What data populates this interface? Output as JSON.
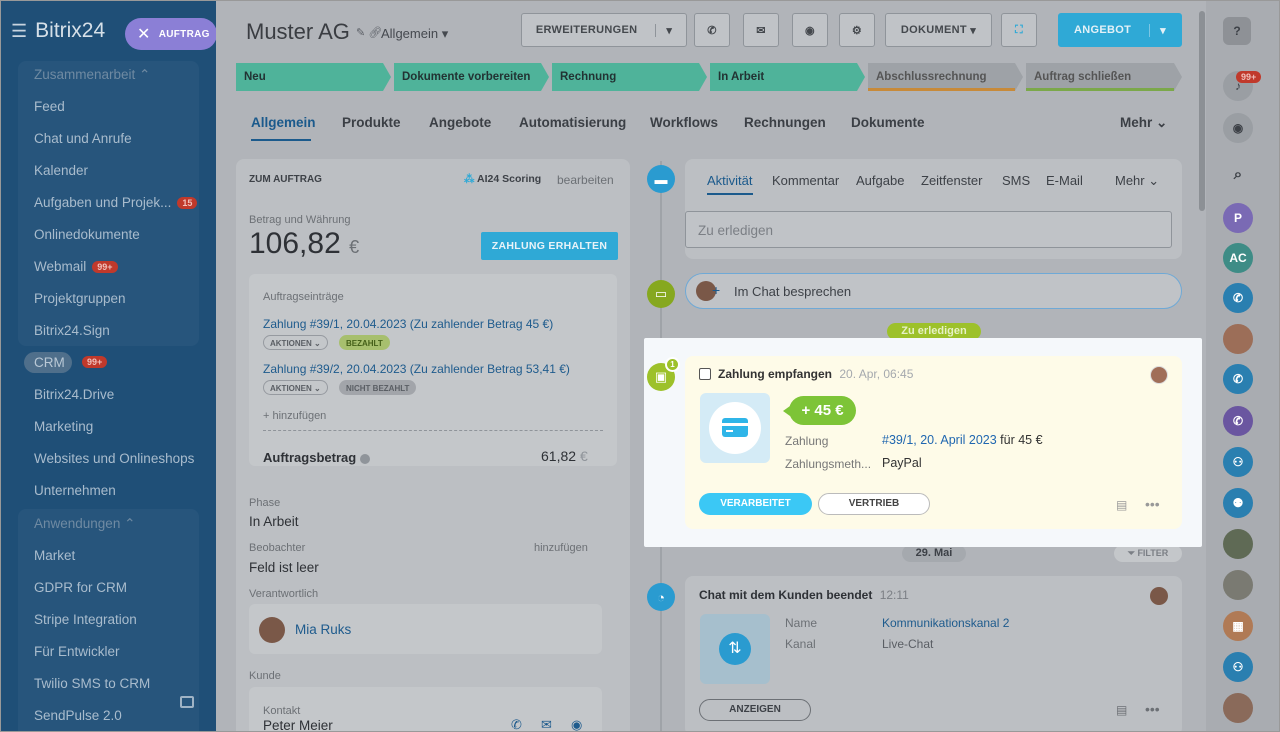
{
  "sidebar": {
    "logo": "Bitrix24",
    "logo_suffix": "2",
    "order_pill": "AUFTRAG",
    "group1_head": "Zusammenarbeit",
    "items1": [
      "Feed",
      "Chat und Anrufe",
      "Kalender",
      "Aufgaben und Projek...",
      "Onlinedokumente",
      "Webmail",
      "Projektgruppen",
      "Bitrix24.Sign"
    ],
    "tasks_badge": "15",
    "webmail_badge": "99+",
    "crm": "CRM",
    "crm_badge": "99+",
    "items2": [
      "Bitrix24.Drive",
      "Marketing",
      "Websites und Onlineshops",
      "Unternehmen"
    ],
    "group2_head": "Anwendungen",
    "items3": [
      "Market",
      "GDPR for CRM",
      "Stripe Integration",
      "Für Entwickler",
      "Twilio SMS to CRM",
      "SendPulse 2.0"
    ]
  },
  "header": {
    "title": "Muster AG",
    "subtitle": "Allgemein",
    "btn_extensions": "ERWEITERUNGEN",
    "btn_document": "DOKUMENT",
    "btn_offer": "ANGEBOT"
  },
  "stages": [
    {
      "label": "Neu",
      "color": "#4fb39a"
    },
    {
      "label": "Dokumente vorbereiten",
      "color": "#4fb39a"
    },
    {
      "label": "Rechnung",
      "color": "#4fb39a"
    },
    {
      "label": "In Arbeit",
      "color": "#4fb39a"
    },
    {
      "label": "Abschlussrechnung",
      "color": "#9ea2a7"
    },
    {
      "label": "Auftrag schließen",
      "color": "#9ea2a7"
    }
  ],
  "tabs": [
    "Allgemein",
    "Produkte",
    "Angebote",
    "Automatisierung",
    "Workflows",
    "Rechnungen",
    "Dokumente"
  ],
  "tab_more": "Mehr",
  "order": {
    "header": "ZUM AUFTRAG",
    "scoring": "AI24 Scoring",
    "edit": "bearbeiten",
    "amount_label": "Betrag und Währung",
    "amount": "106,82",
    "currency": "€",
    "btn_paid": "ZAHLUNG ERHALTEN",
    "entries_label": "Auftragseinträge",
    "payment1": "Zahlung #39/1, 20.04.2023 (Zu zahlender Betrag 45 €)",
    "payment2": "Zahlung #39/2, 20.04.2023 (Zu zahlender Betrag 53,41 €)",
    "actions": "AKTIONEN",
    "paid": "BEZAHLT",
    "not_paid": "NICHT BEZAHLT",
    "add": "+ hinzufügen",
    "total_label": "Auftragsbetrag",
    "total_value": "61,82",
    "phase_label": "Phase",
    "phase_value": "In Arbeit",
    "observer_label": "Beobachter",
    "observer_add": "hinzufügen",
    "observer_value": "Feld ist leer",
    "responsible_label": "Verantwortlich",
    "responsible_name": "Mia Ruks",
    "customer_label": "Kunde",
    "contact_label": "Kontakt",
    "contact_name": "Peter Meier"
  },
  "activity": {
    "tabs": [
      "Aktivität",
      "Kommentar",
      "Aufgabe",
      "Zeitfenster",
      "SMS",
      "E-Mail"
    ],
    "more": "Mehr",
    "todo_placeholder": "Zu erledigen",
    "chat_discuss": "Im Chat besprechen",
    "todo_badge": "Zu erledigen"
  },
  "payment_card": {
    "title": "Zahlung empfangen",
    "time": "20. Apr, 06:45",
    "amount": "+ 45 €",
    "row1_label": "Zahlung",
    "row1_link": "#39/1, 20. April 2023",
    "row1_suffix": "für 45 €",
    "row2_label": "Zahlungsmeth...",
    "row2_value": "PayPal",
    "btn_processed": "VERARBEITET",
    "btn_sales": "VERTRIEB",
    "counter": "1"
  },
  "date_badge": "29. Mai",
  "filter": "FILTER",
  "chat_card": {
    "title": "Chat mit dem Kunden beendet",
    "time": "12:11",
    "name_label": "Name",
    "name_value": "Kommunikationskanal 2",
    "channel_label": "Kanal",
    "channel_value": "Live-Chat",
    "btn_show": "ANZEIGEN"
  },
  "rightbar": {
    "bell_badge": "99+",
    "user_p": "P",
    "user_ac": "AC"
  }
}
